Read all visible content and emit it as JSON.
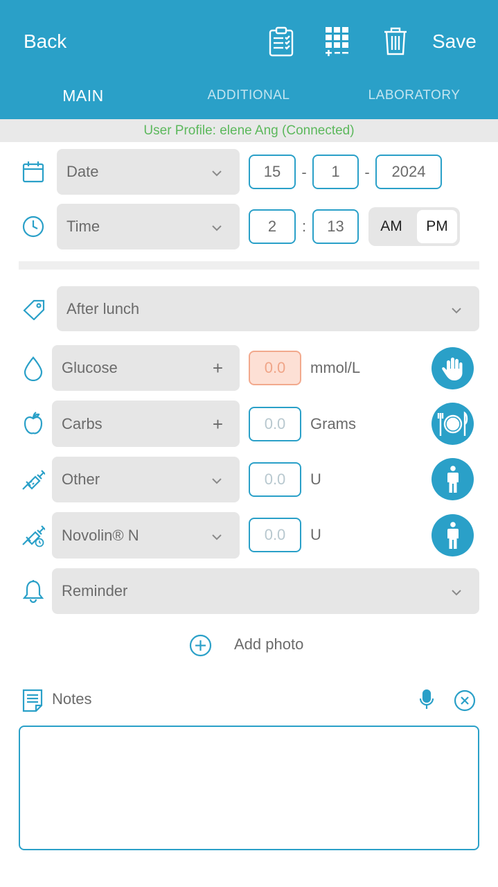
{
  "header": {
    "back_label": "Back",
    "save_label": "Save",
    "tabs": [
      {
        "label": "MAIN",
        "active": true
      },
      {
        "label": "ADDITIONAL",
        "active": false
      },
      {
        "label": "LABORATORY",
        "active": false
      }
    ],
    "icons": [
      "clipboard-checklist-icon",
      "keypad-grid-icon",
      "trash-icon"
    ]
  },
  "profile_bar": {
    "text": "User Profile: elene Ang (Connected)"
  },
  "date_row": {
    "icon": "calendar-icon",
    "select_label": "Date",
    "day": "15",
    "month": "1",
    "year": "2024",
    "sep": "-"
  },
  "time_row": {
    "icon": "clock-icon",
    "select_label": "Time",
    "hour": "2",
    "minute": "13",
    "sep": ":",
    "am_label": "AM",
    "pm_label": "PM",
    "selected": "PM"
  },
  "tag_row": {
    "icon": "tag-icon",
    "value": "After lunch"
  },
  "entries": [
    {
      "icon": "drop-icon",
      "label": "Glucose",
      "control": "+",
      "value": "0.0",
      "unit": "mmol/L",
      "action_icon": "hand-icon"
    },
    {
      "icon": "apple-icon",
      "label": "Carbs",
      "control": "+",
      "value": "0.0",
      "unit": "Grams",
      "action_icon": "plate-cutlery-icon"
    },
    {
      "icon": "syringe-icon",
      "label": "Other",
      "control": "chevron",
      "value": "0.0",
      "unit": "U",
      "action_icon": "person-icon"
    },
    {
      "icon": "syringe-clock-icon",
      "label": "Novolin® N",
      "control": "chevron",
      "value": "0.0",
      "unit": "U",
      "action_icon": "person-icon"
    }
  ],
  "reminder": {
    "icon": "bell-icon",
    "label": "Reminder"
  },
  "add_photo": {
    "label": "Add photo",
    "icon": "add-circle-icon"
  },
  "notes": {
    "label": "Notes",
    "icon": "notes-icon",
    "mic_icon": "microphone-icon",
    "clear_icon": "clear-circle-icon",
    "value": ""
  },
  "colors": {
    "accent": "#2aa0c8",
    "field_bg": "#e6e6e6",
    "profile_text": "#5cb85c",
    "alert_bg": "#fde0d5"
  }
}
